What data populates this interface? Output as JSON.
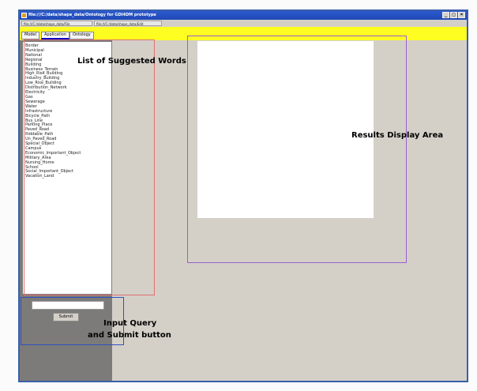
{
  "window": {
    "title": "file:///C:/data/shape_data/Ontology for GDI4DM prototype",
    "address_tabs": [
      "file:///C:/data/shape_data/File",
      "file:///C:/data/shape_data/Edit"
    ],
    "controls": {
      "minimize": "_",
      "maximize": "□",
      "close": "×"
    }
  },
  "tabs": [
    {
      "label": "Model",
      "active": false
    },
    {
      "label": "Application",
      "active": true
    },
    {
      "label": "Ontology",
      "active": false
    }
  ],
  "word_list": [
    "Border",
    "Municipal",
    "National",
    "Regional",
    "Building",
    "Business_Terrain",
    "High_Rise_Building",
    "Industry_Building",
    "Low_Rise_Building",
    "Distribution_Network",
    "Electricity",
    "Gas",
    "Sewerage",
    "Water",
    "Infrastructure",
    "Bicycle_Path",
    "Bus_Line",
    "Parking_Place",
    "Paved_Road",
    "Riddable_Path",
    "Un_Paved_Road",
    "Special_Object",
    "Campus",
    "Economic_Important_Object",
    "Military_Area",
    "Nursing_Home",
    "School",
    "Social_Important_Object",
    "Vacation_Land"
  ],
  "query": {
    "value": "",
    "placeholder": "",
    "submit_label": "Submit"
  },
  "annotations": {
    "suggested_words": "List of Suggested Words",
    "results_area": "Results Display Area",
    "input_query_line1": "Input Query",
    "input_query_line2": "and Submit button"
  },
  "colors": {
    "titlebar": "#1f48b3",
    "tabbar": "#fdfd22",
    "panel": "#d4d0c8",
    "left_strip": "#7c7b79",
    "annot_red": "#e07070",
    "annot_purple": "#9a5fcf",
    "annot_blue": "#3050c0"
  }
}
